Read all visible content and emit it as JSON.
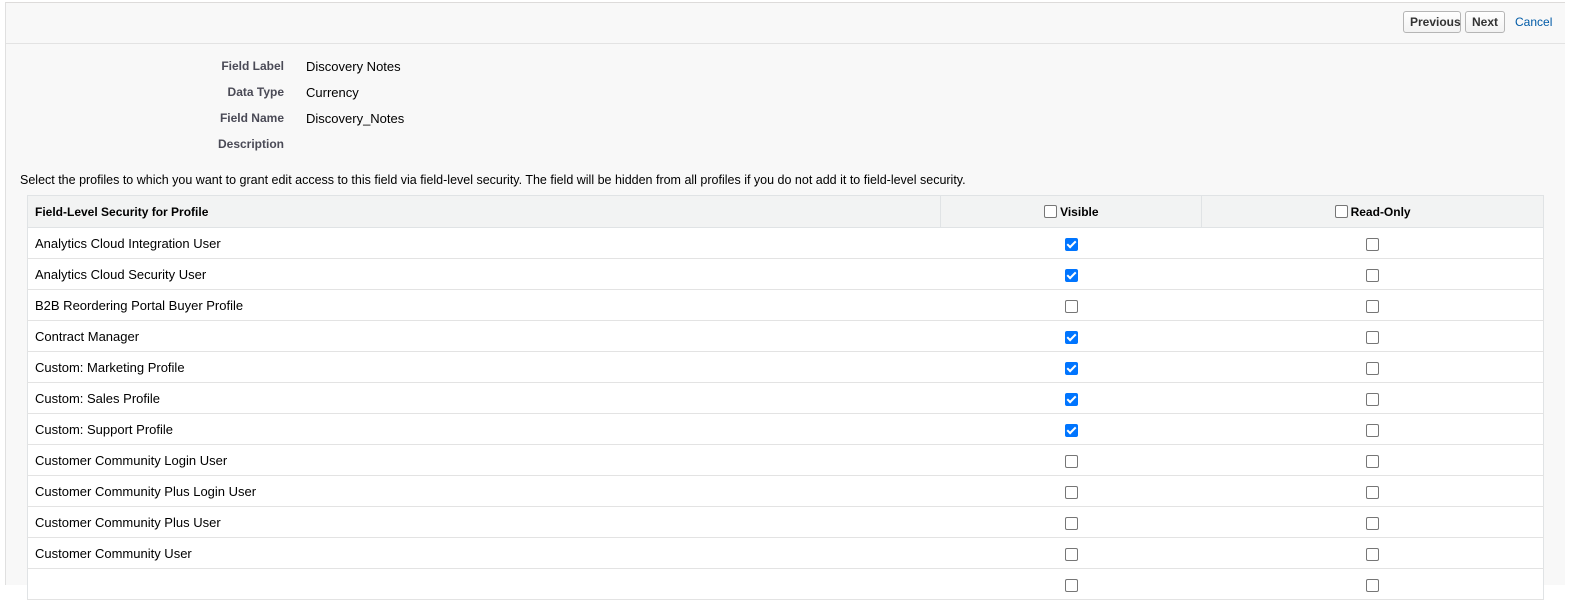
{
  "toolbar": {
    "previous_label": "Previous",
    "next_label": "Next",
    "cancel_label": "Cancel"
  },
  "field_info": {
    "field_label_label": "Field Label",
    "field_label_value": "Discovery Notes",
    "data_type_label": "Data Type",
    "data_type_value": "Currency",
    "field_name_label": "Field Name",
    "field_name_value": "Discovery_Notes",
    "description_label": "Description",
    "description_value": ""
  },
  "instructions": "Select the profiles to which you want to grant edit access to this field via field-level security. The field will be hidden from all profiles if you do not add it to field-level security.",
  "table": {
    "headers": {
      "profile": "Field-Level Security for Profile",
      "visible": "Visible",
      "read_only": "Read-Only"
    },
    "header_visible_checked": false,
    "header_read_only_checked": false,
    "rows": [
      {
        "profile": "Analytics Cloud Integration User",
        "visible": true,
        "read_only": false
      },
      {
        "profile": "Analytics Cloud Security User",
        "visible": true,
        "read_only": false
      },
      {
        "profile": "B2B Reordering Portal Buyer Profile",
        "visible": false,
        "read_only": false
      },
      {
        "profile": "Contract Manager",
        "visible": true,
        "read_only": false
      },
      {
        "profile": "Custom: Marketing Profile",
        "visible": true,
        "read_only": false
      },
      {
        "profile": "Custom: Sales Profile",
        "visible": true,
        "read_only": false
      },
      {
        "profile": "Custom: Support Profile",
        "visible": true,
        "read_only": false
      },
      {
        "profile": "Customer Community Login User",
        "visible": false,
        "read_only": false
      },
      {
        "profile": "Customer Community Plus Login User",
        "visible": false,
        "read_only": false
      },
      {
        "profile": "Customer Community Plus User",
        "visible": false,
        "read_only": false
      },
      {
        "profile": "Customer Community User",
        "visible": false,
        "read_only": false
      },
      {
        "profile": "",
        "visible": false,
        "read_only": false
      }
    ]
  },
  "colors": {
    "checkbox_checked": "#0075ff",
    "link": "#015ba7",
    "header_bg": "#f2f3f3",
    "page_bg": "#f8f8f8"
  }
}
